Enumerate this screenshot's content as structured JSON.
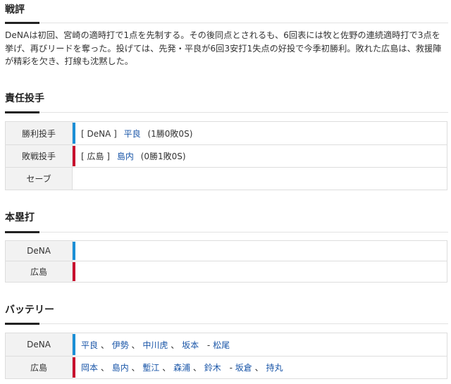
{
  "colors": {
    "dena": "#1b8fd6",
    "hiroshima": "#c8102e",
    "link": "#1a56a8"
  },
  "review": {
    "title": "戦評",
    "text": "DeNAは初回、宮崎の適時打で1点を先制する。その後同点とされるも、6回表には牧と佐野の連続適時打で3点を挙げ、再びリードを奪った。投げては、先発・平良が6回3安打1失点の好投で今季初勝利。敗れた広島は、救援陣が精彩を欠き、打線も沈黙した。"
  },
  "pitchers": {
    "title": "責任投手",
    "win": {
      "label": "勝利投手",
      "team": "[ DeNA ]",
      "name": "平良",
      "record": "(1勝0敗0S)"
    },
    "loss": {
      "label": "敗戦投手",
      "team": "[ 広島 ]",
      "name": "島内",
      "record": "(0勝1敗0S)"
    },
    "save": {
      "label": "セーブ"
    }
  },
  "homeruns": {
    "title": "本塁打",
    "rows": [
      {
        "team": "DeNA"
      },
      {
        "team": "広島"
      }
    ]
  },
  "battery": {
    "title": "バッテリー",
    "dena": {
      "team": "DeNA",
      "pitchers": [
        "平良",
        "伊勢",
        "中川虎",
        "坂本"
      ],
      "catchers": [
        "松尾"
      ]
    },
    "hiroshima": {
      "team": "広島",
      "pitchers": [
        "岡本",
        "島内",
        "塹江",
        "森浦",
        "鈴木"
      ],
      "catchers": [
        "坂倉",
        "持丸"
      ]
    },
    "separator": "、",
    "dash": "-"
  }
}
